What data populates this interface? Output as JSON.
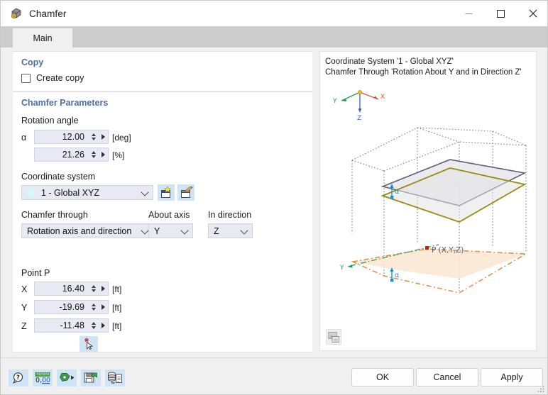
{
  "window": {
    "title": "Chamfer",
    "app_icon": "chamfer-icon",
    "minimize_label": "—",
    "maximize_label": "□",
    "close_label": "✕"
  },
  "tabs": [
    {
      "label": "Main",
      "active": true
    }
  ],
  "copy_section": {
    "title": "Copy",
    "checkbox_label": "Create copy",
    "checked": false
  },
  "chamfer_parameters": {
    "title": "Chamfer Parameters",
    "rotation_angle": {
      "label": "Rotation angle",
      "alpha_symbol": "α",
      "deg_value": "12.00",
      "deg_unit": "[deg]",
      "pct_value": "21.26",
      "pct_unit": "[%]"
    },
    "coordinate_system": {
      "label": "Coordinate system",
      "value": "1 - Global XYZ",
      "swatch_color": "#d7f6f6",
      "new_button_icon": "new-coordinate-system-icon",
      "edit_button_icon": "edit-coordinate-system-icon"
    },
    "chamfer_through": {
      "label": "Chamfer through",
      "value": "Rotation axis and direction"
    },
    "about_axis": {
      "label": "About axis",
      "value": "Y"
    },
    "in_direction": {
      "label": "In direction",
      "value": "Z"
    },
    "point_p": {
      "label": "Point P",
      "rows": [
        {
          "axis": "X",
          "value": "16.40",
          "unit": "[ft]"
        },
        {
          "axis": "Y",
          "value": "-19.69",
          "unit": "[ft]"
        },
        {
          "axis": "Z",
          "value": "-11.48",
          "unit": "[ft]"
        }
      ],
      "pick_button_icon": "pick-point-cursor-icon"
    }
  },
  "preview": {
    "line1": "Coordinate System '1 - Global XYZ'",
    "line2": "Chamfer Through 'Rotation About Y and in Direction Z'",
    "axis_labels": {
      "x": "X",
      "y": "Y",
      "z": "Z"
    },
    "graphic_labels": {
      "point": "P (X,Y,Z)",
      "angle_upper": "α",
      "angle_lower": "α",
      "axis_y_lower": "Y"
    },
    "colors": {
      "x_axis": "#d4553a",
      "y_axis": "#1f9e4f",
      "z_axis": "#3a5fcd",
      "origin": "#f2c40f",
      "gold_plane": "#9a8b12",
      "gray_plane": "#5c5f7a",
      "orange_plane": "#e08b42",
      "dimension": "#1f8fd0",
      "point_marker": "#cc2200"
    },
    "corner_icon": "image-export-icon"
  },
  "bottom_toolbar": {
    "buttons": [
      {
        "icon": "help-icon"
      },
      {
        "icon": "units-decimal-places-icon"
      },
      {
        "icon": "settings-arrow-icon"
      },
      {
        "icon": "save-settings-icon"
      },
      {
        "icon": "database-document-icon"
      }
    ]
  },
  "dialog_buttons": {
    "ok": "OK",
    "cancel": "Cancel",
    "apply": "Apply"
  }
}
